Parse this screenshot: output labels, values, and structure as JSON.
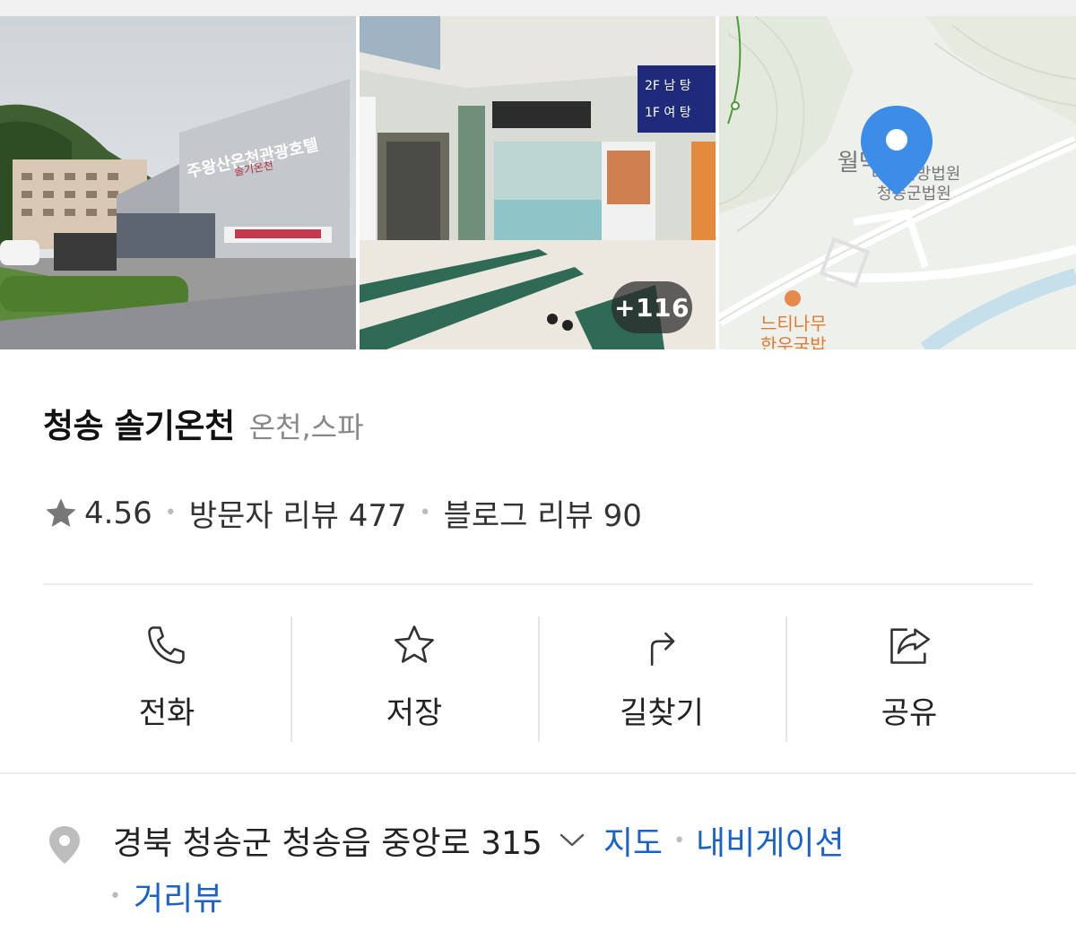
{
  "gallery": {
    "photos": [
      "hotel-exterior-photo",
      "lobby-interior-photo",
      "location-map-thumbnail"
    ],
    "more_count": "+116",
    "map": {
      "pin_color": "#3b8de8",
      "label_court": "대구지방법원",
      "label_court_branch": "청송군법원",
      "label_partial": "월막",
      "label_restaurant": "느티나무",
      "label_restaurant_sub": "한우국밥"
    }
  },
  "place": {
    "name": "청송 솔기온천",
    "category": "온천,스파"
  },
  "rating": {
    "score": "4.56",
    "visitor_reviews": "방문자 리뷰 477",
    "blog_reviews": "블로그 리뷰 90"
  },
  "actions": [
    {
      "label": "전화",
      "icon": "phone-icon"
    },
    {
      "label": "저장",
      "icon": "star-outline-icon"
    },
    {
      "label": "길찾기",
      "icon": "directions-arrow-icon"
    },
    {
      "label": "공유",
      "icon": "share-icon"
    }
  ],
  "address": {
    "text": "경북 청송군 청송읍 중앙로 315",
    "links": [
      "지도",
      "내비게이션",
      "거리뷰"
    ]
  },
  "colors": {
    "link": "#1a62c9",
    "text_primary": "#111111",
    "text_secondary": "#888888",
    "pin": "#3b8de8"
  }
}
